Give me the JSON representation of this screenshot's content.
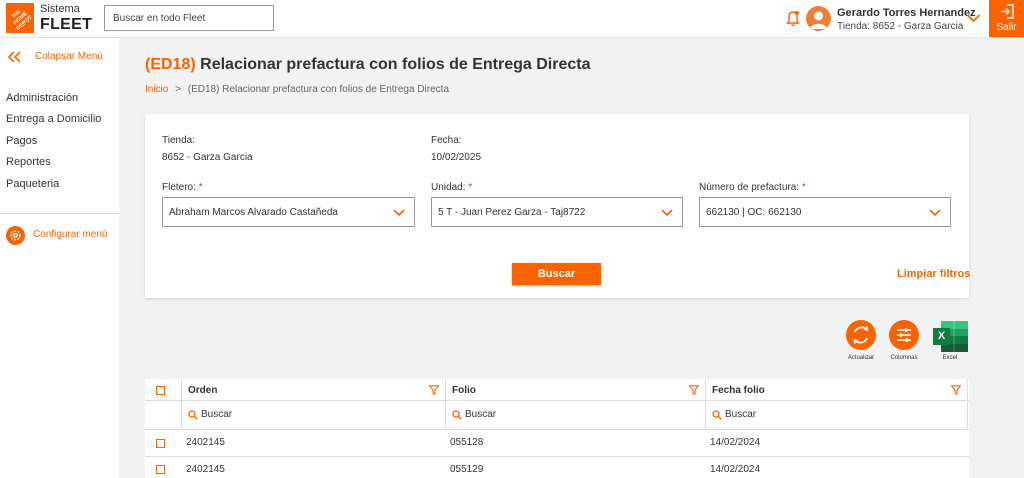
{
  "header": {
    "brand_line1": "Sistema",
    "brand_line2": "FLEET",
    "logo_text": "THE HOME DEPOT",
    "search_placeholder": "Buscar en todo Fleet",
    "user_name": "Gerardo Torres Hernandez",
    "user_store": "Tienda: 8652 - Garza Garcia",
    "exit_label": "Salir"
  },
  "sidebar": {
    "collapse_label": "Colapsar Menú",
    "items": [
      {
        "label": "Administración"
      },
      {
        "label": "Entrega a Domicilio"
      },
      {
        "label": "Pagos"
      },
      {
        "label": "Reportes"
      },
      {
        "label": "Paqueteria"
      }
    ],
    "config_label": "Configurar menú"
  },
  "page": {
    "code": "(ED18)",
    "title": "Relacionar prefactura con folios de Entrega Directa",
    "breadcrumb_home": "Inicio",
    "breadcrumb_sep": ">",
    "breadcrumb_current": "(ED18) Relacionar prefactura con folios de Entrega Directa"
  },
  "form": {
    "tienda_label": "Tienda:",
    "tienda_value": "8652 - Garza Garcia",
    "fecha_label": "Fecha:",
    "fecha_value": "10/02/2025",
    "fletero_label": "Fletero:",
    "fletero_value": "Abraham Marcos Alvarado Castañeda",
    "unidad_label": "Unidad:",
    "unidad_value": "5 T - Juan Perez Garza - Taj8722",
    "prefactura_label": "Número de prefactura:",
    "prefactura_value": "662130 | OC: 662130",
    "required_mark": "*",
    "search_button": "Buscar",
    "clear_filters": "Limpiar filtros"
  },
  "actions": {
    "refresh_label": "Actualizar",
    "columns_label": "Columnas",
    "excel_label": "Excel",
    "excel_letter": "X"
  },
  "table": {
    "columns": [
      {
        "label": "Orden"
      },
      {
        "label": "Folio"
      },
      {
        "label": "Fecha folio"
      }
    ],
    "search_placeholder": "Buscar",
    "rows": [
      {
        "orden": "2402145",
        "folio": "055128",
        "fecha": "14/02/2024"
      },
      {
        "orden": "2402145",
        "folio": "055129",
        "fecha": "14/02/2024"
      }
    ]
  },
  "colors": {
    "accent": "#f96302",
    "avatar": "#f07f36",
    "excel_green": "#1e7145",
    "required": "#d32f2f"
  },
  "icons": [
    "home-depot-logo-icon",
    "bell-icon",
    "user-avatar-icon",
    "chevron-down-icon",
    "exit-icon",
    "double-chevron-left-icon",
    "gear-icon",
    "refresh-icon",
    "sliders-icon",
    "excel-icon",
    "filter-icon",
    "search-icon"
  ]
}
